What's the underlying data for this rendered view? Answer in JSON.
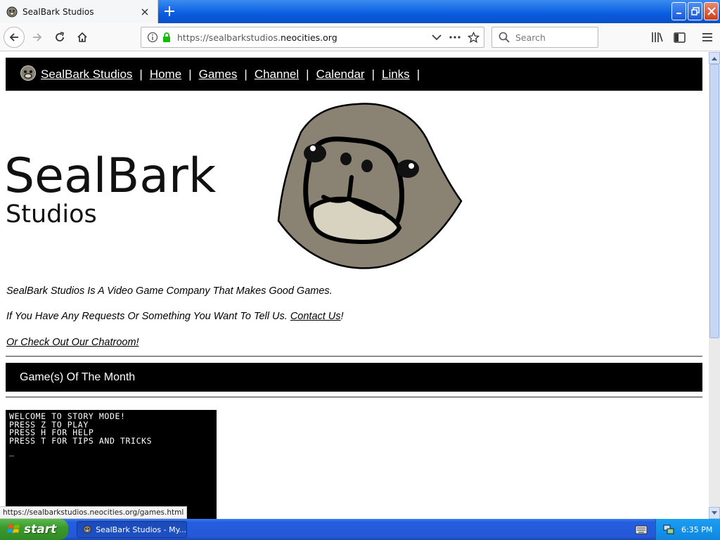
{
  "browser": {
    "tab_title": "SealBark Studios",
    "url_prefix": "https://sealbarkstudios.",
    "url_host": "neocities.org",
    "search_placeholder": "Search",
    "status_url": "https://sealbarkstudios.neocities.org/games.html"
  },
  "site": {
    "nav": [
      {
        "label": "SealBark Studios"
      },
      {
        "label": "Home"
      },
      {
        "label": "Games"
      },
      {
        "label": "Channel"
      },
      {
        "label": "Calendar"
      },
      {
        "label": "Links"
      }
    ],
    "separator": "|",
    "hero_title": "SealBark",
    "hero_subtitle": "Studios",
    "intro_line_1": "SealBark Studios Is A Video Game Company That Makes Good Games.",
    "intro_line_2_text": "If You Have Any Requests Or Something You Want To Tell Us. ",
    "intro_line_2_link": "Contact Us",
    "intro_line_2_suffix": "!",
    "intro_line_3_link": "Or Check Out Our Chatroom!",
    "gotm_heading": "Game(s) Of The Month",
    "game_screen_lines": [
      "WELCOME TO STORY MODE!",
      "PRESS Z TO PLAY",
      "PRESS H FOR HELP",
      "PRESS T FOR TIPS AND TRICKS",
      "_"
    ]
  },
  "taskbar": {
    "start_label": "start",
    "task_label": "SealBark Studios - My...",
    "clock": "6:35 PM"
  },
  "colors": {
    "seal_body": "#8a8374",
    "seal_muzzle": "#d8d2c0",
    "nav_bg": "#000000"
  }
}
